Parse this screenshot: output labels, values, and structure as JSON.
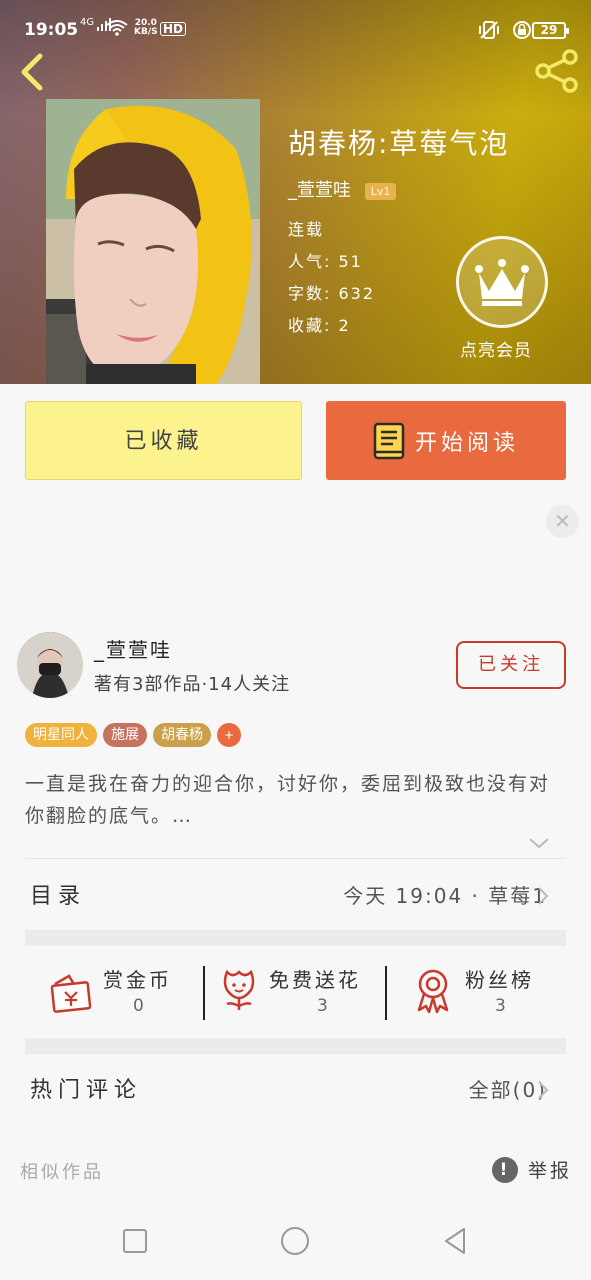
{
  "status_bar": {
    "time": "19:05",
    "network": "4G",
    "speed_value": "20.0",
    "speed_unit": "KB/S",
    "hd": "HD",
    "battery": "29"
  },
  "book": {
    "title": "胡春杨:草莓气泡",
    "author": "_萱萱哇",
    "level": "Lv1",
    "status": "连载",
    "popularity": "人气: 51",
    "word_count": "字数: 632",
    "favorites": "收藏: 2",
    "vip_label": "点亮会员"
  },
  "actions": {
    "collected_label": "已收藏",
    "read_label": "开始阅读"
  },
  "author_card": {
    "name": "_萱萱哇",
    "stats": "著有3部作品·14人关注",
    "follow_label": "已关注"
  },
  "tags": [
    {
      "label": "明星同人",
      "color": "#f0b23c"
    },
    {
      "label": "施展",
      "color": "#c5735e"
    },
    {
      "label": "胡春杨",
      "color": "#caa14a"
    },
    {
      "label": "+",
      "color": "#e96a3e"
    }
  ],
  "summary": "一直是我在奋力的迎合你，讨好你，委屈到极致也没有对你翻脸的底气。…",
  "toc": {
    "title": "目录",
    "latest": "今天 19:04 · 草莓1"
  },
  "stats": {
    "coins_label": "赏金币",
    "coins_value": "0",
    "flowers_label": "免费送花",
    "flowers_value": "3",
    "fans_label": "粉丝榜",
    "fans_value": "3"
  },
  "comments": {
    "title": "热门评论",
    "all": "全部(0)"
  },
  "footer": {
    "similar": "相似作品",
    "report": "举报"
  },
  "colors": {
    "accent_orange": "#e96a3e",
    "collected_yellow": "#fcf38e",
    "follow_red": "#c93a2c",
    "icon_red": "#c93a2c"
  }
}
